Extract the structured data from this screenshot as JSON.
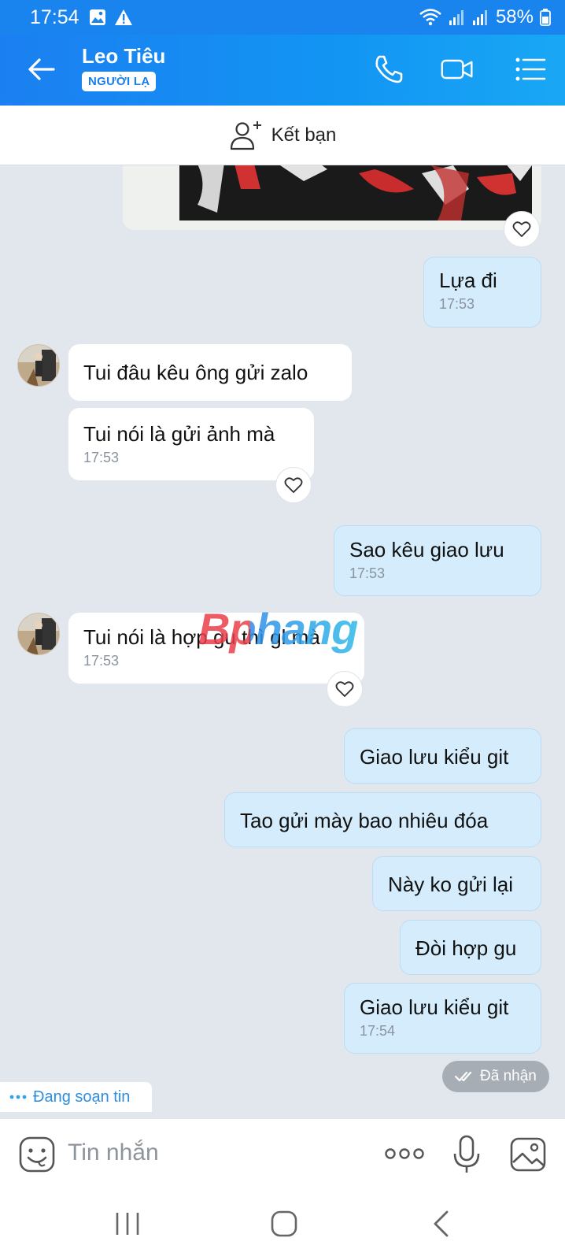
{
  "status_bar": {
    "time": "17:54",
    "battery": "58%"
  },
  "header": {
    "title": "Leo Tiêu",
    "badge": "NGƯỜI LẠ"
  },
  "add_friend": {
    "label": "Kết bạn"
  },
  "watermark": "Bphang",
  "messages": [
    {
      "side": "out",
      "text": "Lựa đi",
      "time": "17:53"
    },
    {
      "side": "in",
      "text": "Tui đâu kêu ông gửi zalo"
    },
    {
      "side": "in",
      "text": "Tui nói là gửi ảnh mà",
      "time": "17:53"
    },
    {
      "side": "out",
      "text": "Sao kêu giao lưu",
      "time": "17:53"
    },
    {
      "side": "in",
      "text": "Tui nói là hợp gu thì gl mà",
      "time": "17:53"
    },
    {
      "side": "out",
      "text": "Giao lưu kiểu git"
    },
    {
      "side": "out",
      "text": "Tao gửi mày bao nhiêu đóa"
    },
    {
      "side": "out",
      "text": "Này ko gửi lại"
    },
    {
      "side": "out",
      "text": "Đòi hợp gu"
    },
    {
      "side": "out",
      "text": "Giao lưu kiểu git",
      "time": "17:54"
    }
  ],
  "delivery_status": "Đã nhận",
  "typing_indicator": "Đang soạn tin",
  "composer": {
    "placeholder": "Tin nhắn"
  },
  "colors": {
    "header": "#1a84ee",
    "outgoing_bubble": "#d4ecfb",
    "chat_bg": "#e2e7ee",
    "accent": "#2d8ee0"
  }
}
